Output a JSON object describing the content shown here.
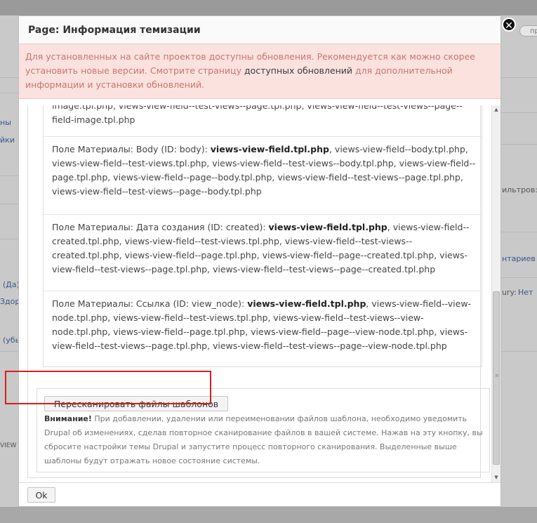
{
  "dialog": {
    "title": "Page: Информация темизации",
    "close_glyph": "✕",
    "warning": {
      "text_before": "Для установленных на сайте проектов доступны обновления. Рекомендуется как можно скорее установить новые версии. Смотрите страницу ",
      "link": "доступных обновлений",
      "text_after": " для дополнительной информации и установки обновлений."
    },
    "fields": [
      {
        "prefix": "",
        "bold": "",
        "rest": "image.tpl.php, views-view-field--test-views--page.tpl.php, views-view-field--test-views--page--field-image.tpl.php"
      },
      {
        "prefix": "Поле Материалы: Body (ID: body): ",
        "bold": "views-view-field.tpl.php",
        "rest": ", views-view-field--body.tpl.php, views-view-field--test-views.tpl.php, views-view-field--test-views--body.tpl.php, views-view-field--page.tpl.php, views-view-field--page--body.tpl.php, views-view-field--test-views--page.tpl.php, views-view-field--test-views--page--body.tpl.php"
      },
      {
        "prefix": "Поле Материалы: Дата создания (ID: created): ",
        "bold": "views-view-field.tpl.php",
        "rest": ", views-view-field--created.tpl.php, views-view-field--test-views.tpl.php, views-view-field--test-views--created.tpl.php, views-view-field--page.tpl.php, views-view-field--page--created.tpl.php, views-view-field--test-views--page.tpl.php, views-view-field--test-views--page--created.tpl.php"
      },
      {
        "prefix": "Поле Материалы: Ссылка (ID: view_node): ",
        "bold": "views-view-field.tpl.php",
        "rest": ", views-view-field--view-node.tpl.php, views-view-field--test-views.tpl.php, views-view-field--test-views--view-node.tpl.php, views-view-field--page.tpl.php, views-view-field--page--view-node.tpl.php, views-view-field--test-views--page.tpl.php, views-view-field--test-views--page--view-node.tpl.php"
      }
    ],
    "rescan_button": "Пересканировать файлы шаблонов",
    "note_bold": "Внимание!",
    "note_text": " При добавлении, удалении или переименовании файлов шаблона, необходимо уведомить Drupal об изменениях, сделав повторное сканирование файлов в вашей системе. Нажав на эту кнопку, вы сбросите настройки темы Drupal и запустите процесс повторного сканирования. Выделенные выше шаблоны будут отражать новое состояние системы.",
    "ok_button": "Ok",
    "scroll_position": 0.55
  },
  "background": {
    "pill": "пр",
    "left": [
      "ны",
      "йки",
      "(Да)",
      "Здор",
      "(убы",
      "VIEW"
    ],
    "right": [
      "ильтров:",
      "нтариев",
      "ury:",
      "Нет"
    ]
  }
}
